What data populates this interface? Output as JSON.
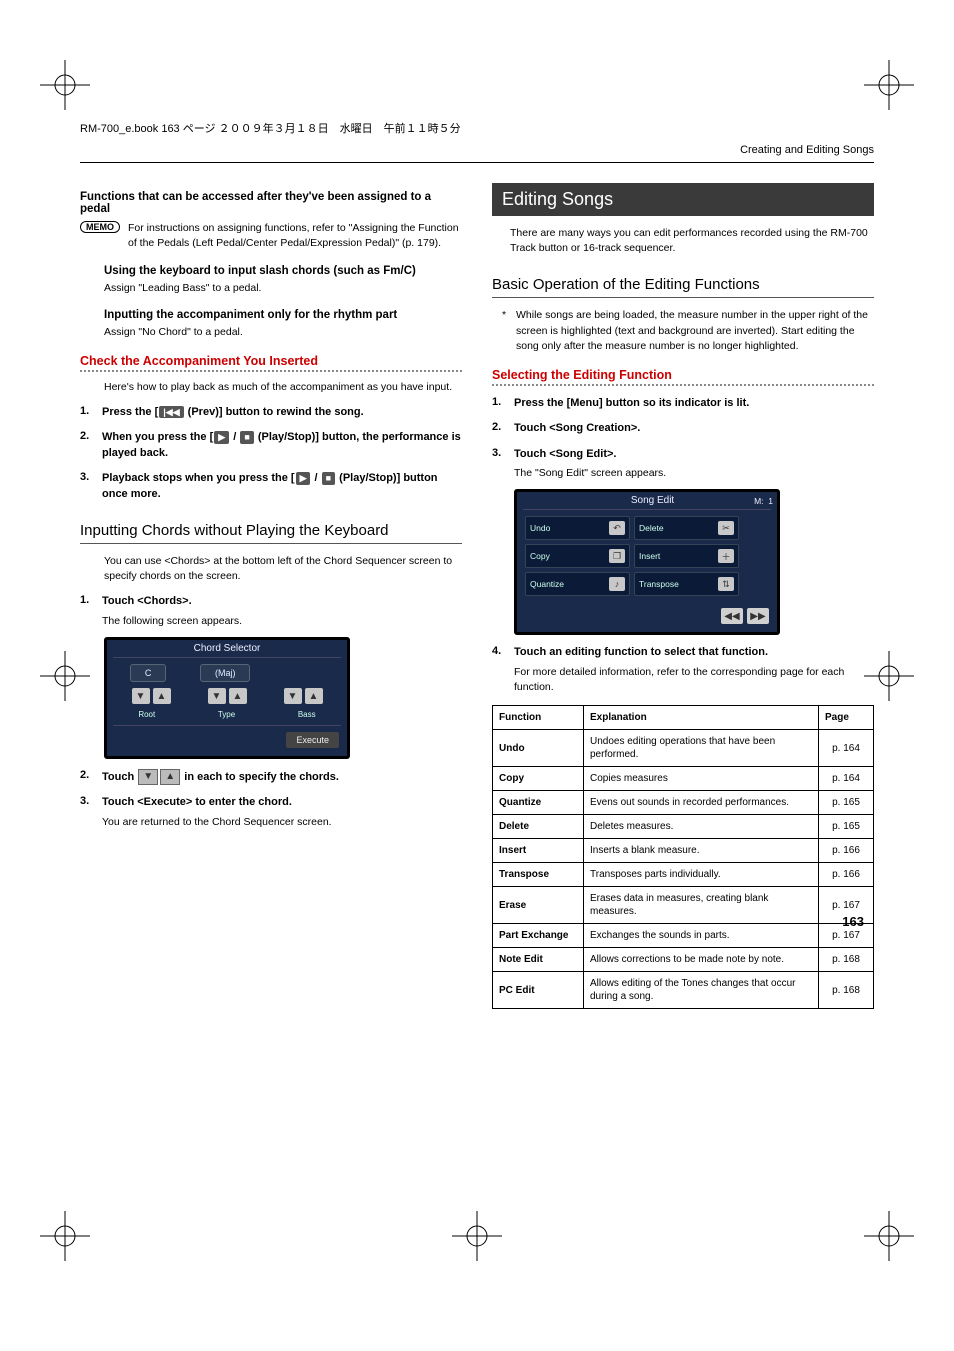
{
  "meta": {
    "running_head": "RM-700_e.book  163 ページ  ２００９年３月１８日　水曜日　午前１１時５分",
    "section_header_right": "Creating and Editing Songs",
    "page_number": "163"
  },
  "left": {
    "pedal_heading": "Functions that can be accessed after they've been assigned to a pedal",
    "memo_label": "MEMO",
    "memo_text": "For instructions on assigning functions, refer to \"Assigning the Function of the Pedals (Left Pedal/Center Pedal/Expression Pedal)\" (p. 179).",
    "slash_heading": "Using the keyboard to input slash chords (such as Fm/C)",
    "slash_body": "Assign \"Leading Bass\" to a pedal.",
    "rhythm_heading": "Inputting the accompaniment only for the rhythm part",
    "rhythm_body": "Assign \"No Chord\" to a pedal.",
    "check_heading": "Check the Accompaniment You Inserted",
    "check_intro": "Here's how to play back as much of the accompaniment as you have input.",
    "step1_prefix": "Press the [",
    "step1_suffix": " (Prev)] button to rewind the song.",
    "step2_prefix": "When you press the [",
    "step2_suffix": " (Play/Stop)] button, the performance is played back.",
    "step3_prefix": "Playback stops when you press the [",
    "step3_suffix": " (Play/Stop)] button once more.",
    "input_heading": "Inputting Chords without Playing the Keyboard",
    "input_intro": "You can use <Chords> at the bottom left of the Chord Sequencer screen to specify chords on the screen.",
    "chords_step1": "Touch <Chords>.",
    "chords_step1_body": "The following screen appears.",
    "chord_screenshot": {
      "title": "Chord Selector",
      "root_value": "C",
      "type_value": "(Maj)",
      "root_label": "Root",
      "type_label": "Type",
      "bass_label": "Bass",
      "execute_label": "Execute"
    },
    "chords_step2_prefix": "Touch ",
    "chords_step2_suffix": " in each to specify the chords.",
    "chords_step3": "Touch <Execute> to enter the chord.",
    "chords_step3_body": "You are returned to the Chord Sequencer screen."
  },
  "right": {
    "editing_heading": "Editing Songs",
    "editing_intro": "There are many ways you can edit performances recorded using the RM-700 Track button or 16-track sequencer.",
    "basic_heading": "Basic Operation of the Editing Functions",
    "basic_note": "While songs are being loaded, the measure number in the upper right of the screen is highlighted (text and background are inverted). Start editing the song only after the measure number is no longer highlighted.",
    "selecting_heading": "Selecting the Editing Function",
    "sel_step1": "Press the [Menu] button so its indicator is lit.",
    "sel_step2": "Touch <Song Creation>.",
    "sel_step3": "Touch <Song Edit>.",
    "sel_step3_body": "The \"Song Edit\" screen appears.",
    "song_edit_screenshot": {
      "title": "Song Edit",
      "measure_label": "M:",
      "measure_value": "1",
      "buttons": [
        "Undo",
        "Delete",
        "Copy",
        "Insert",
        "Quantize",
        "Transpose"
      ]
    },
    "sel_step4": "Touch an editing function to select that function.",
    "sel_step4_body": "For more detailed information, refer to the corresponding page for each function.",
    "table": {
      "headers": [
        "Function",
        "Explanation",
        "Page"
      ],
      "rows": [
        {
          "fn": "Undo",
          "exp": "Undoes editing operations that have been performed.",
          "pg": "p. 164"
        },
        {
          "fn": "Copy",
          "exp": "Copies measures",
          "pg": "p. 164"
        },
        {
          "fn": "Quantize",
          "exp": "Evens out sounds in recorded performances.",
          "pg": "p. 165"
        },
        {
          "fn": "Delete",
          "exp": "Deletes measures.",
          "pg": "p. 165"
        },
        {
          "fn": "Insert",
          "exp": "Inserts a blank measure.",
          "pg": "p. 166"
        },
        {
          "fn": "Transpose",
          "exp": "Transposes parts individually.",
          "pg": "p. 166"
        },
        {
          "fn": "Erase",
          "exp": "Erases data in measures, creating blank measures.",
          "pg": "p. 167"
        },
        {
          "fn": "Part Exchange",
          "exp": "Exchanges the sounds in parts.",
          "pg": "p. 167"
        },
        {
          "fn": "Note Edit",
          "exp": "Allows corrections to be made note by note.",
          "pg": "p. 168"
        },
        {
          "fn": "PC Edit",
          "exp": "Allows editing of the Tones changes that occur during a song.",
          "pg": "p. 168"
        }
      ]
    }
  }
}
